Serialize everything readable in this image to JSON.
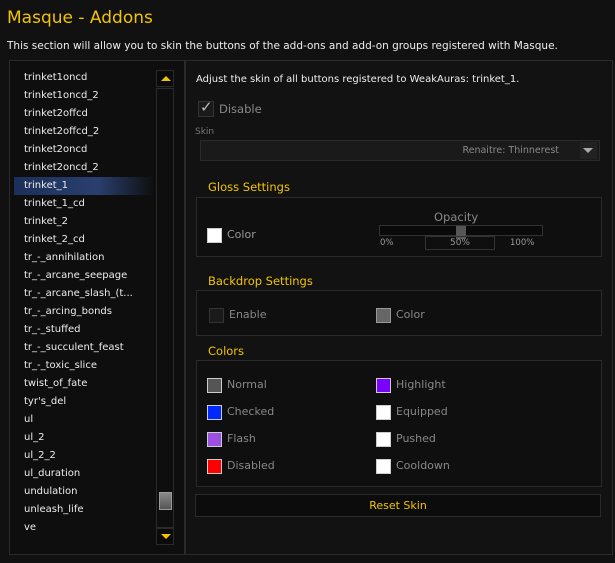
{
  "title": "Masque - Addons",
  "description": "This section will allow you to skin the buttons of the add-ons and add-on groups registered with Masque.",
  "list": {
    "items": [
      "trinket1oncd",
      "trinket1oncd_2",
      "trinket2offcd",
      "trinket2offcd_2",
      "trinket2oncd",
      "trinket2oncd_2",
      "trinket_1",
      "trinket_1_cd",
      "trinket_2",
      "trinket_2_cd",
      "tr_-_annihilation",
      "tr_-_arcane_seepage",
      "tr_-_arcane_slash_(t...",
      "tr_-_arcing_bonds",
      "tr_-_stuffed",
      "tr_-_succulent_feast",
      "tr_-_toxic_slice",
      "twist_of_fate",
      "tyr's_del",
      "ul",
      "ul_2",
      "ul_2_2",
      "ul_duration",
      "undulation",
      "unleash_life",
      "ve"
    ],
    "selected": "trinket_1"
  },
  "detail": {
    "heading": "Adjust the skin of all buttons registered to WeakAuras: trinket_1.",
    "disable_label": "Disable",
    "skin_label": "Skin",
    "skin_value": "Renaitre: Thinnerest",
    "gloss": {
      "title": "Gloss Settings",
      "color_label": "Color",
      "color": "#ffffff",
      "opacity_label": "Opacity",
      "opacity_min": "0%",
      "opacity_max": "100%",
      "opacity_value": "50%",
      "opacity": 50
    },
    "backdrop": {
      "title": "Backdrop Settings",
      "enable_label": "Enable",
      "color_label": "Color",
      "color": "#666666"
    },
    "colors": {
      "title": "Colors",
      "items": [
        {
          "label": "Normal",
          "color": "#555555"
        },
        {
          "label": "Highlight",
          "color": "#7a00ff"
        },
        {
          "label": "Checked",
          "color": "#0028ff"
        },
        {
          "label": "Equipped",
          "color": "#ffffff"
        },
        {
          "label": "Flash",
          "color": "#9a50e0"
        },
        {
          "label": "Pushed",
          "color": "#ffffff"
        },
        {
          "label": "Disabled",
          "color": "#ff0000"
        },
        {
          "label": "Cooldown",
          "color": "#ffffff"
        }
      ]
    },
    "reset_label": "Reset Skin"
  }
}
